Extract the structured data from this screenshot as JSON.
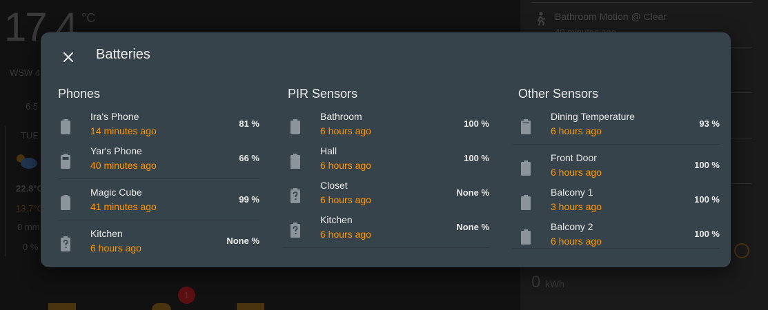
{
  "background": {
    "temperature": "17.4",
    "temp_unit": "°C",
    "wind": "WSW 4",
    "time": "6:5",
    "day": "TUE",
    "high": "22.8°C",
    "low": "13.7°C",
    "rain": "0 mm",
    "precip": "0 %",
    "motion_label": "Bathroom Motion @ Clear",
    "motion_time": "40 minutes ago",
    "energy_value": "0",
    "energy_unit": "kWh",
    "badge_count": "1"
  },
  "dialog": {
    "title": "Batteries",
    "columns": [
      {
        "title": "Phones",
        "items": [
          {
            "name": "Ira's Phone",
            "time": "14 minutes ago",
            "value": "81 %",
            "icon": "battery-icon"
          },
          {
            "name": "Yar's Phone",
            "time": "40 minutes ago",
            "value": "66 %",
            "icon": "battery-icon"
          },
          {
            "name": "Magic Cube",
            "time": "41 minutes ago",
            "value": "99 %",
            "icon": "battery-icon"
          },
          {
            "name": "Kitchen",
            "time": "6 hours ago",
            "value": "None %",
            "icon": "battery-unknown-icon"
          }
        ]
      },
      {
        "title": "PIR Sensors",
        "items": [
          {
            "name": "Bathroom",
            "time": "6 hours ago",
            "value": "100 %",
            "icon": "battery-icon"
          },
          {
            "name": "Hall",
            "time": "6 hours ago",
            "value": "100 %",
            "icon": "battery-icon"
          },
          {
            "name": "Closet",
            "time": "6 hours ago",
            "value": "None %",
            "icon": "battery-unknown-icon"
          },
          {
            "name": "Kitchen",
            "time": "6 hours ago",
            "value": "None %",
            "icon": "battery-unknown-icon"
          }
        ]
      },
      {
        "title": "Other Sensors",
        "items": [
          {
            "name": "Dining Temperature",
            "time": "6 hours ago",
            "value": "93 %",
            "icon": "battery-icon"
          },
          {
            "name": "Front Door",
            "time": "6 hours ago",
            "value": "100 %",
            "icon": "battery-icon"
          },
          {
            "name": "Balcony 1",
            "time": "3 hours ago",
            "value": "100 %",
            "icon": "battery-icon"
          },
          {
            "name": "Balcony 2",
            "time": "6 hours ago",
            "value": "100 %",
            "icon": "battery-icon"
          }
        ]
      }
    ]
  },
  "colors": {
    "dialog_bg": "#37434a",
    "accent_time": "#ff9800",
    "text": "#eaeaea",
    "icon": "#8a949a"
  }
}
